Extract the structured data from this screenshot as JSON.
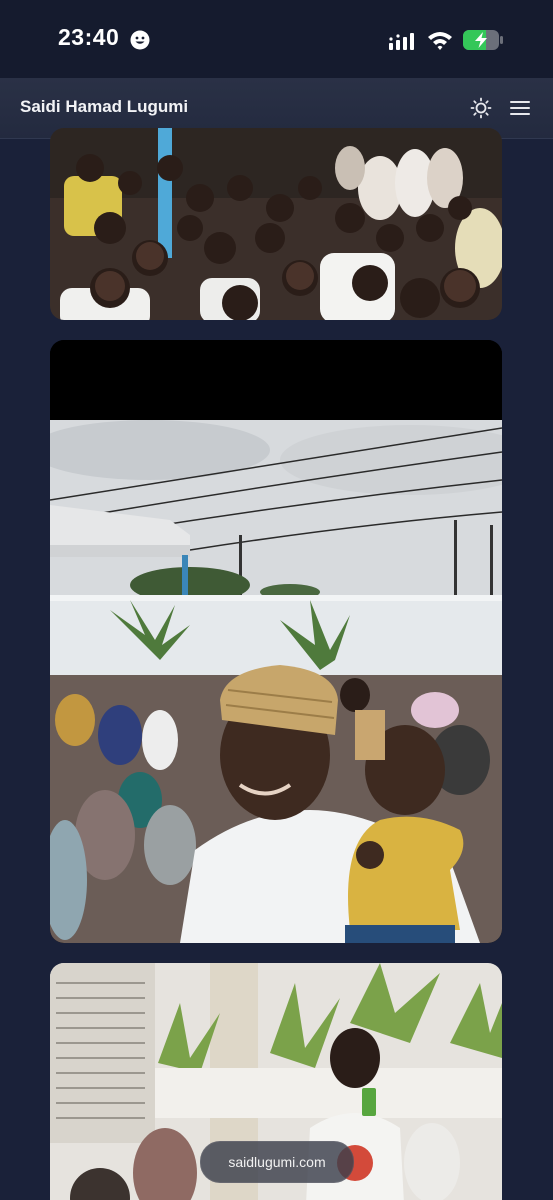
{
  "status_bar": {
    "time": "23:40",
    "icons": [
      "smiley-icon",
      "signal-icon",
      "wifi-icon",
      "battery-charging-icon"
    ]
  },
  "header": {
    "title": "Saidi Hamad Lugumi",
    "icons": [
      "sun-icon",
      "menu-icon"
    ]
  },
  "photos": [
    {
      "name": "photo-crowd-children"
    },
    {
      "name": "photo-man-holding-child"
    },
    {
      "name": "photo-boy-drinking-juice"
    }
  ],
  "footer": {
    "url": "saidlugumi.com"
  },
  "colors": {
    "background": "#1a2139",
    "header": "#262d43",
    "battery_green": "#34c759"
  }
}
